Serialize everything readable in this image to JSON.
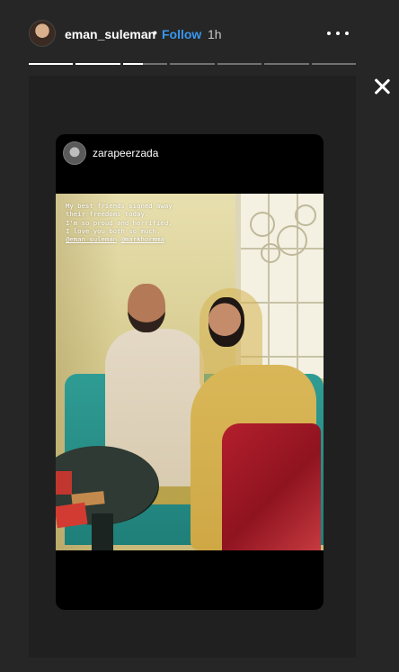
{
  "header": {
    "username": "eman_suleman",
    "separator": "•",
    "follow_label": "Follow",
    "time_ago": "1h",
    "more_icon": "more-horizontal-icon",
    "close_icon": "close-icon"
  },
  "progress": {
    "segments": [
      1,
      1,
      0.45,
      0,
      0,
      0,
      0
    ]
  },
  "reshared_post": {
    "username": "zarapeerzada",
    "caption_lines": [
      "My best friends signed away",
      "their freedoms today.",
      "I'm so proud and horrified.",
      "I love you both so much."
    ],
    "mentions": [
      "@eman_suleman",
      "@markhormma"
    ]
  },
  "colors": {
    "background": "#262626",
    "follow_blue": "#3897f0",
    "card_background": "#000000"
  }
}
